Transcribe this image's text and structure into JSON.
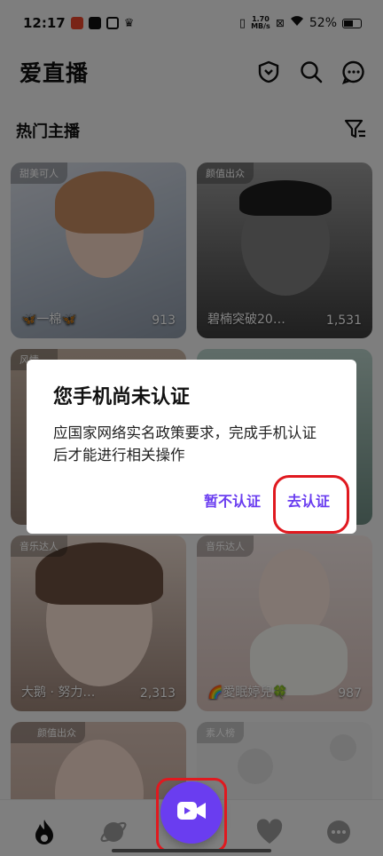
{
  "status_bar": {
    "time": "12:17",
    "net_speed_value": "1.70",
    "net_speed_unit": "MB/s",
    "battery": "52%"
  },
  "header": {
    "title": "爱直播",
    "icons": [
      "shield-icon",
      "search-icon",
      "chat-icon"
    ]
  },
  "section": {
    "label": "热门主播",
    "filter_icon": "filter-icon"
  },
  "cards": [
    {
      "tag": "甜美可人",
      "name": "🦋一棉🦋",
      "viewers": "913"
    },
    {
      "tag": "颜值出众",
      "name": "碧楠突破20…",
      "viewers": "1,531"
    },
    {
      "tag": "风情…",
      "name": "",
      "viewers": ""
    },
    {
      "tag": "",
      "name": "",
      "viewers": ""
    },
    {
      "tag": "音乐达人",
      "name": "大鹅 · 努力…",
      "viewers": "2,313"
    },
    {
      "tag": "音乐达人",
      "name": "🌈愛眠婷兒🍀",
      "viewers": "987"
    },
    {
      "tag": "颜值出众",
      "name": "",
      "viewers": ""
    },
    {
      "tag": "素人榜",
      "name": "",
      "viewers": ""
    }
  ],
  "dialog": {
    "title": "您手机尚未认证",
    "message": "应国家网络实名政策要求，完成手机认证后才能进行相关操作",
    "cancel_label": "暂不认证",
    "confirm_label": "去认证"
  },
  "bottom_nav": {
    "items": [
      "flame-icon",
      "planet-icon",
      "video-camera-icon",
      "heart-icon",
      "chat-bubble-icon"
    ]
  },
  "colors": {
    "accent": "#6a3df0",
    "highlight_ring": "#e0191f"
  }
}
